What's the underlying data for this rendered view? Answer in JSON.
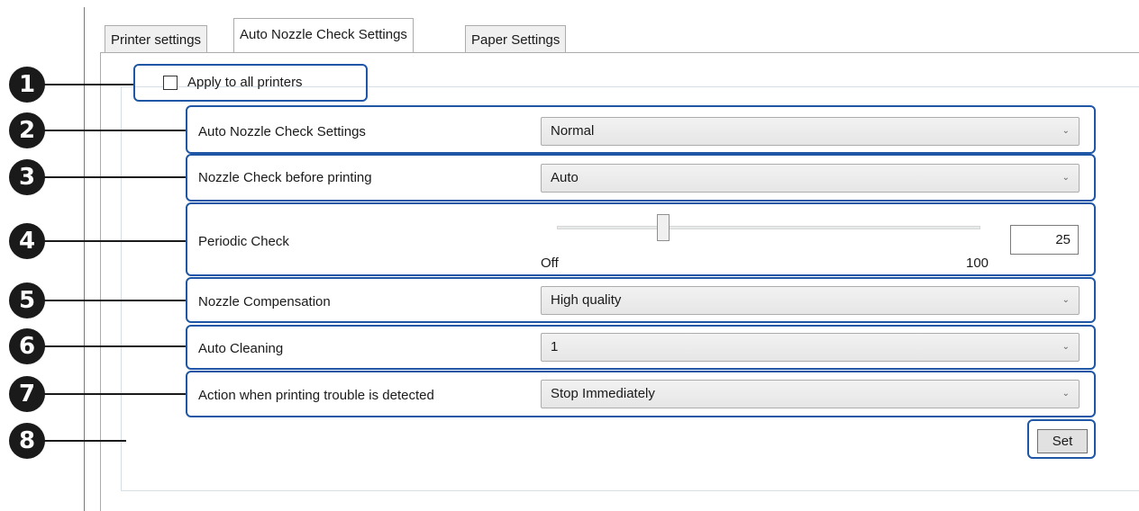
{
  "tabs": [
    {
      "label": "Printer settings"
    },
    {
      "label": "Auto Nozzle Check Settings"
    },
    {
      "label": "Paper Settings"
    }
  ],
  "callouts": [
    "1",
    "2",
    "3",
    "4",
    "5",
    "6",
    "7",
    "8"
  ],
  "apply_all": {
    "label": "Apply to all printers",
    "checked": false
  },
  "rows": {
    "auto_nozzle": {
      "label": "Auto Nozzle Check Settings",
      "value": "Normal"
    },
    "before_printing": {
      "label": "Nozzle Check before printing",
      "value": "Auto"
    },
    "periodic": {
      "label": "Periodic Check",
      "min_label": "Off",
      "max_label": "100",
      "value": "25",
      "slider_fraction": 0.25
    },
    "compensation": {
      "label": "Nozzle Compensation",
      "value": "High quality"
    },
    "auto_cleaning": {
      "label": "Auto Cleaning",
      "value": "1"
    },
    "trouble_action": {
      "label": "Action when printing trouble is detected",
      "value": "Stop Immediately"
    }
  },
  "set_button": {
    "label": "Set"
  },
  "icons": {
    "dropdown": "chevron-down-icon"
  },
  "colors": {
    "callout_frame": "#1f56a5",
    "callout_badge": "#1a1a1a"
  }
}
